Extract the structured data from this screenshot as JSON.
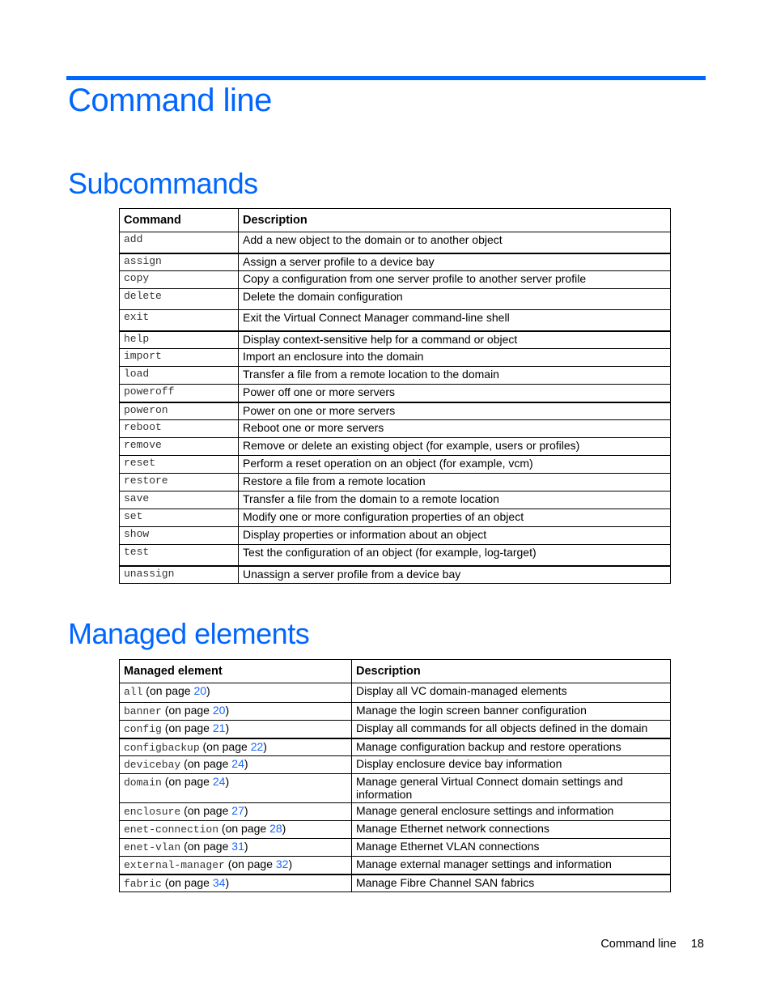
{
  "page_title": "Command line",
  "subcommands": {
    "heading": "Subcommands",
    "headers": [
      "Command",
      "Description"
    ],
    "rows": [
      {
        "command": "add",
        "description": "Add a new object to the domain or to another object"
      },
      {
        "command": "assign",
        "description": "Assign a server profile to a device bay"
      },
      {
        "command": "copy",
        "description": "Copy a configuration from one server profile to another server profile"
      },
      {
        "command": "delete",
        "description": "Delete the domain configuration"
      },
      {
        "command": "exit",
        "description": "Exit the Virtual Connect Manager command-line shell"
      },
      {
        "command": "help",
        "description": "Display context-sensitive help for a command or object"
      },
      {
        "command": "import",
        "description": "Import an enclosure into the domain"
      },
      {
        "command": "load",
        "description": "Transfer a file from a remote location to the domain"
      },
      {
        "command": "poweroff",
        "description": "Power off one or more servers"
      },
      {
        "command": "poweron",
        "description": "Power on one or more servers"
      },
      {
        "command": "reboot",
        "description": "Reboot one or more servers"
      },
      {
        "command": "remove",
        "description": "Remove or delete an existing object (for example, users or profiles)"
      },
      {
        "command": "reset",
        "description": "Perform a reset operation on an object (for example, vcm)"
      },
      {
        "command": "restore",
        "description": "Restore a file from a remote location"
      },
      {
        "command": "save",
        "description": "Transfer a file from the domain to a remote location"
      },
      {
        "command": "set",
        "description": "Modify one or more configuration properties of an object"
      },
      {
        "command": "show",
        "description": "Display properties or information about an object"
      },
      {
        "command": "test",
        "description": "Test the configuration of an object (for example, log-target)"
      },
      {
        "command": "unassign",
        "description": "Unassign a server profile from a device bay"
      }
    ]
  },
  "managed_elements": {
    "heading": "Managed elements",
    "headers": [
      "Managed element",
      "Description"
    ],
    "on_page_prefix": "(on page ",
    "on_page_suffix": ")",
    "rows": [
      {
        "element": "all",
        "page": "20",
        "description": "Display all VC domain-managed elements"
      },
      {
        "element": "banner",
        "page": "20",
        "description": "Manage the login screen banner configuration"
      },
      {
        "element": "config",
        "page": "21",
        "description": "Display all commands for all objects defined in the domain"
      },
      {
        "element": "configbackup",
        "page": "22",
        "description": "Manage configuration backup and restore operations"
      },
      {
        "element": "devicebay",
        "page": "24",
        "description": "Display enclosure device bay information"
      },
      {
        "element": "domain",
        "page": "24",
        "description": "Manage general Virtual Connect domain settings and information"
      },
      {
        "element": "enclosure",
        "page": "27",
        "description": "Manage general enclosure settings and information"
      },
      {
        "element": "enet-connection",
        "page": "28",
        "description": "Manage Ethernet network connections"
      },
      {
        "element": "enet-vlan",
        "page": "31",
        "description": "Manage Ethernet VLAN connections"
      },
      {
        "element": "external-manager",
        "page": "32",
        "description": "Manage external manager settings and information"
      },
      {
        "element": "fabric",
        "page": "34",
        "description": "Manage Fibre Channel SAN fabrics"
      }
    ]
  },
  "footer": {
    "section": "Command line",
    "page_number": "18"
  },
  "colors": {
    "heading": "#0066ff",
    "link": "#1a66ff"
  }
}
